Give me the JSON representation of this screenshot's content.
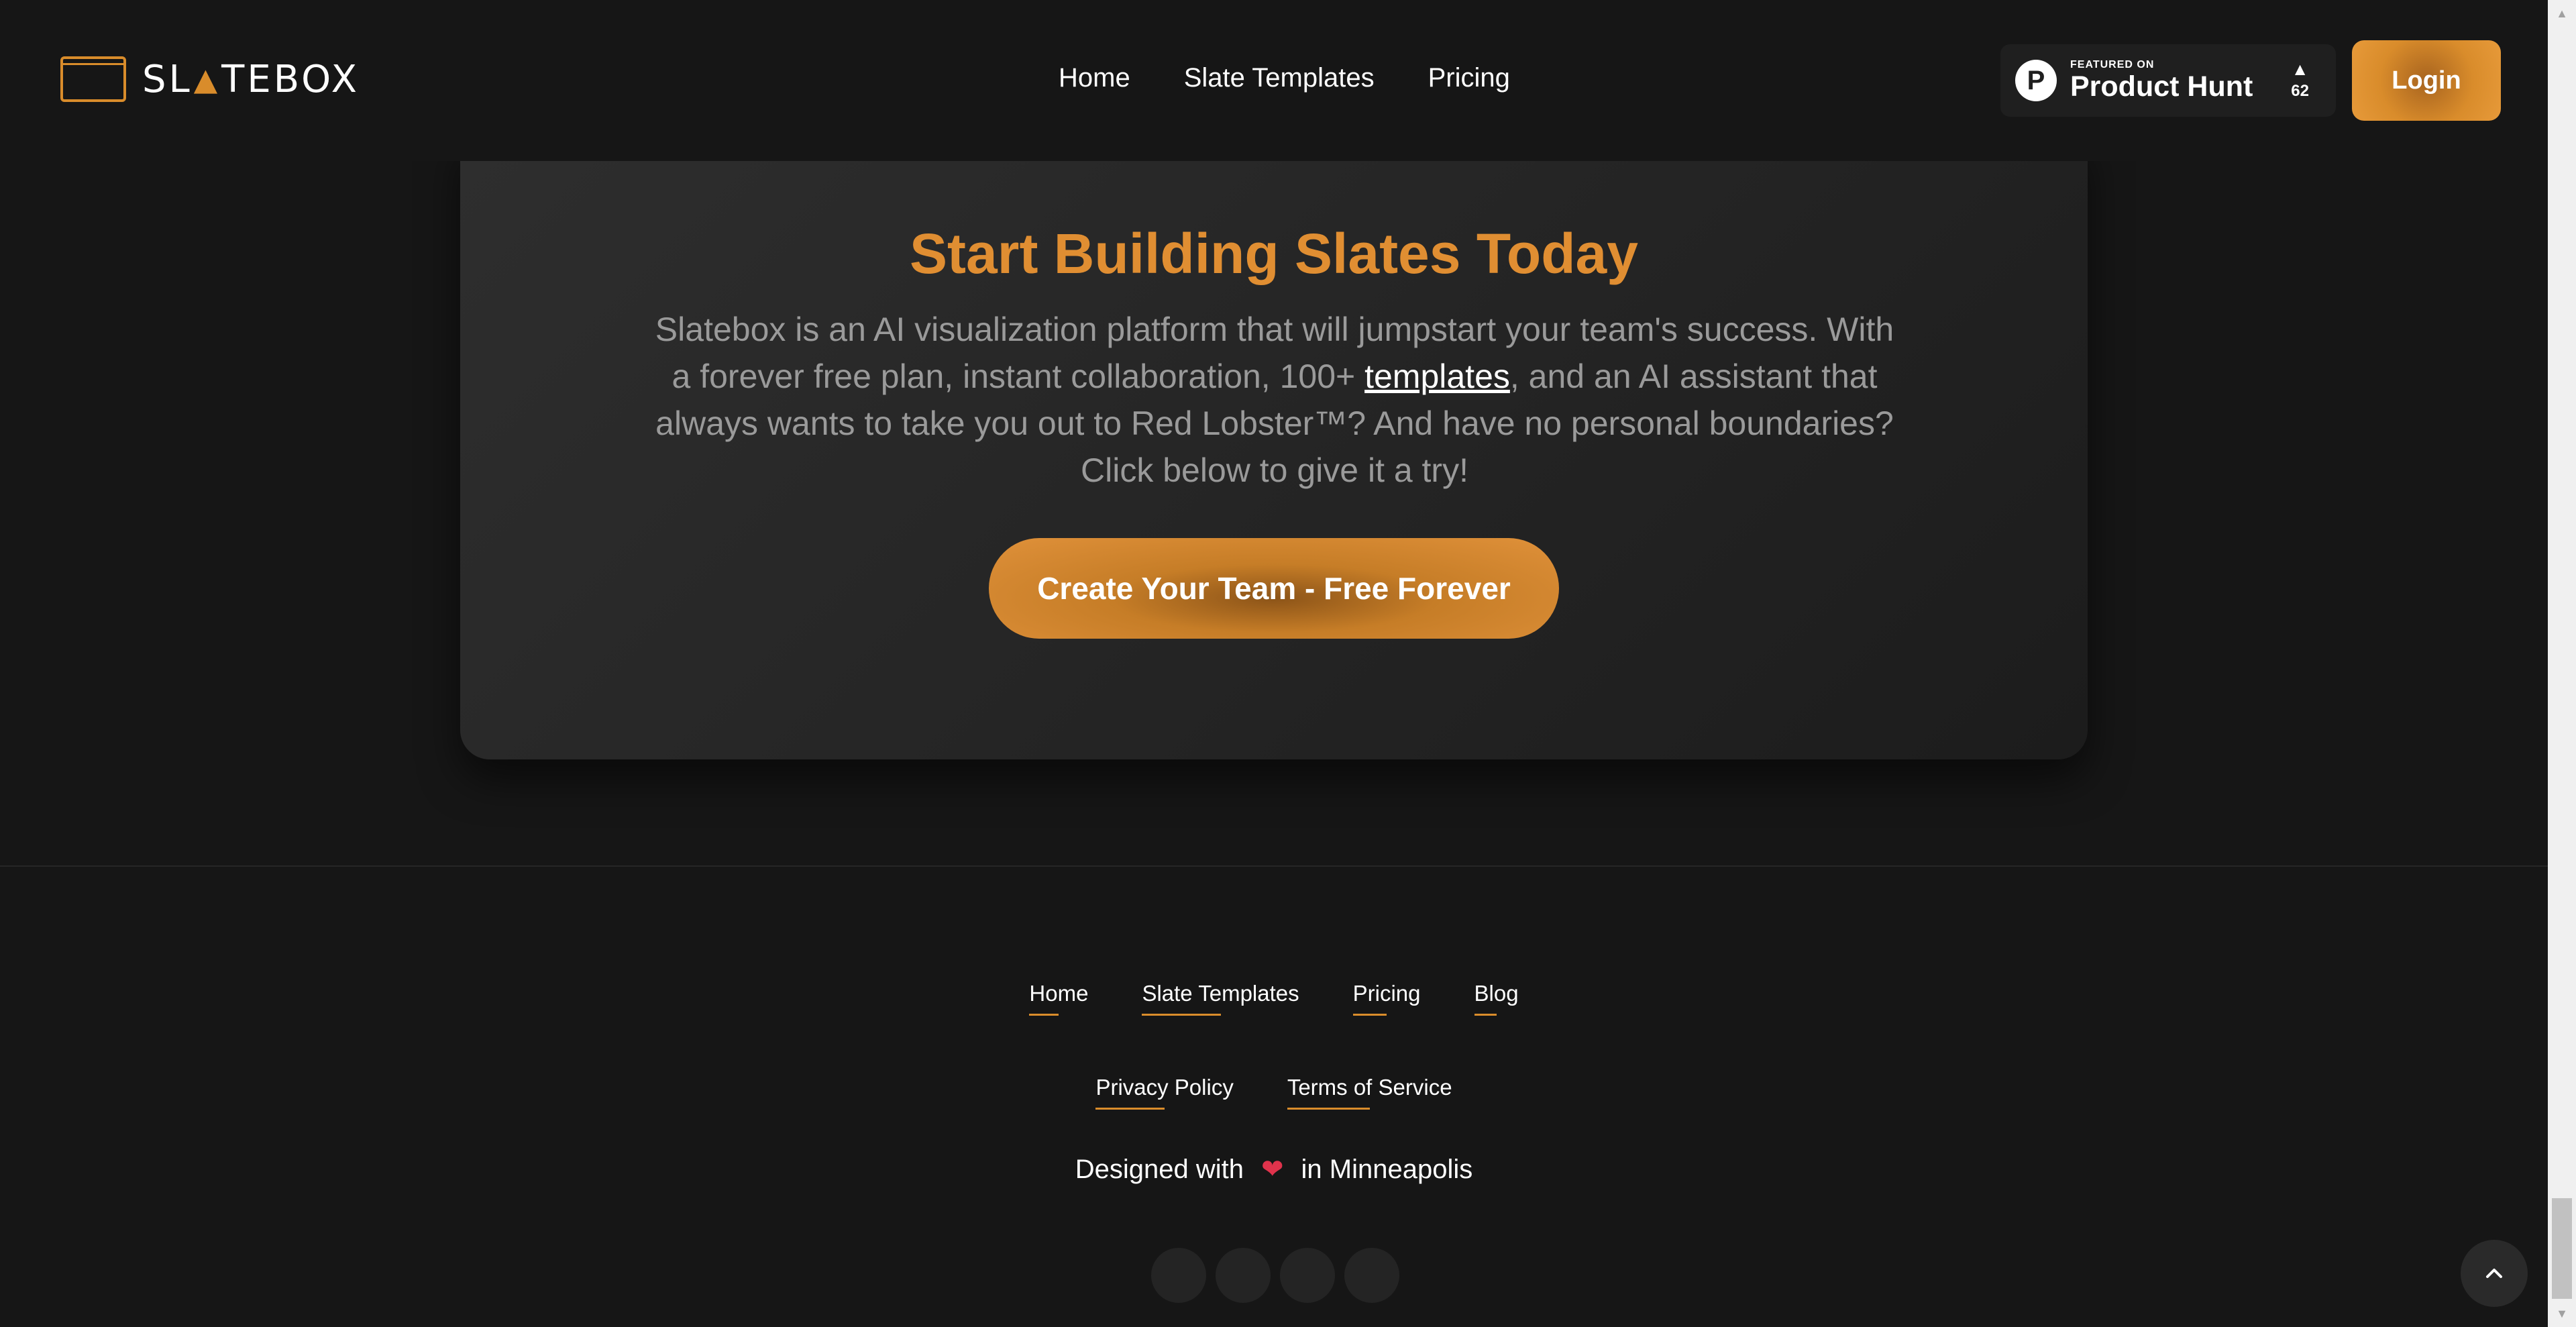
{
  "header": {
    "logo_text_left": "SL",
    "logo_text_right": "TEBOX",
    "nav": [
      {
        "label": "Home"
      },
      {
        "label": "Slate Templates"
      },
      {
        "label": "Pricing"
      }
    ],
    "product_hunt": {
      "featured_on": "FEATURED ON",
      "name": "Product Hunt",
      "logo_letter": "P",
      "vote_arrow": "▲",
      "votes": "62"
    },
    "login_label": "Login"
  },
  "hero": {
    "title": "Start Building Slates Today",
    "body_before_link": "Slatebox is an AI visualization platform that will jumpstart your team's success. With a forever free plan, instant collaboration, 100+ ",
    "link_text": "templates",
    "body_after_link": ", and an AI assistant that always wants to take you out to Red Lobster™? And have no personal boundaries? Click below to give it a try!",
    "cta_label": "Create Your Team - Free Forever"
  },
  "footer": {
    "links_row1": [
      {
        "label": "Home"
      },
      {
        "label": "Slate Templates"
      },
      {
        "label": "Pricing"
      },
      {
        "label": "Blog"
      }
    ],
    "links_row2": [
      {
        "label": "Privacy Policy"
      },
      {
        "label": "Terms of Service"
      }
    ],
    "designed_before": "Designed with",
    "designed_after": "in Minneapolis",
    "heart": "❤"
  },
  "colors": {
    "accent": "#d98c2b",
    "background": "#161616",
    "card": "#2a2a2a"
  },
  "icons": {
    "scroll_top": "chevron-up-icon"
  }
}
